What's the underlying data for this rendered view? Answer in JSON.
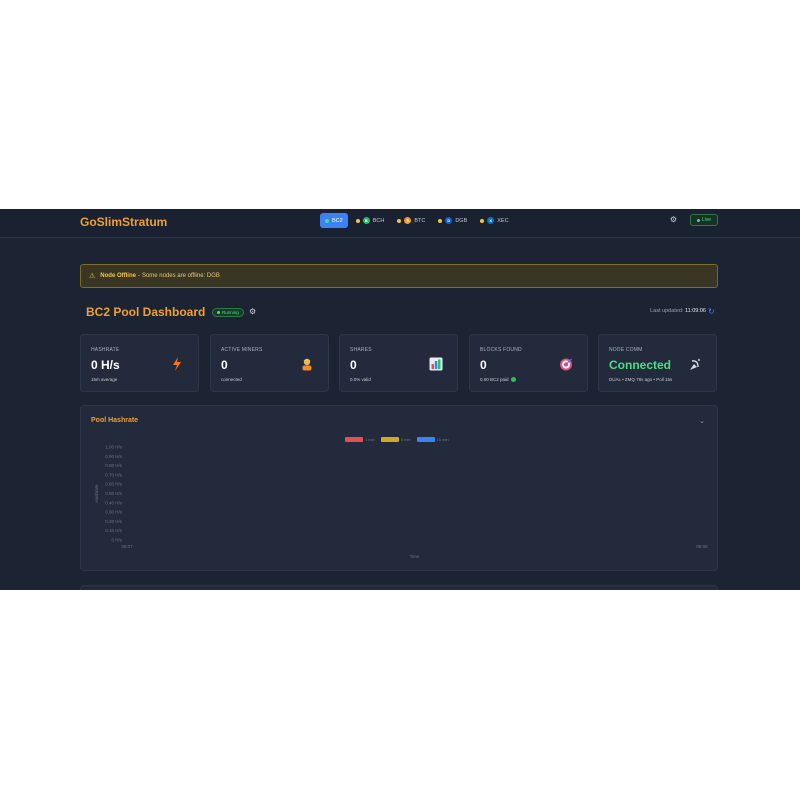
{
  "app": {
    "brand": "GoSlimStratum",
    "chains": [
      {
        "label": "BC2",
        "color": "#4ade80",
        "coin": "",
        "active": true
      },
      {
        "label": "BCH",
        "color": "#f4c542",
        "coin": "B",
        "coin_color": "#2bb673",
        "active": false
      },
      {
        "label": "BTC",
        "color": "#f4c542",
        "coin": "₿",
        "coin_color": "#f7931a",
        "active": false
      },
      {
        "label": "DGB",
        "color": "#f4c542",
        "coin": "D",
        "coin_color": "#0b63d1",
        "active": false
      },
      {
        "label": "XEC",
        "color": "#f4c542",
        "coin": "X",
        "coin_color": "#0074c2",
        "active": false
      }
    ],
    "live_label": "Live"
  },
  "alert": {
    "title": "Node Offline",
    "separator": " - ",
    "message": "Some nodes are offline: DGB"
  },
  "dashboard": {
    "title": "BC2 Pool Dashboard",
    "status": "Running",
    "last_updated_label": "Last updated:",
    "last_updated_time": "11:09:06"
  },
  "stats": [
    {
      "label": "HASHRATE",
      "value": "0 H/s",
      "sub": "15m average",
      "icon": "lightning-icon"
    },
    {
      "label": "ACTIVE MINERS",
      "value": "0",
      "sub": "connected",
      "icon": "miner-icon"
    },
    {
      "label": "SHARES",
      "value": "0",
      "sub": "0.0% valid",
      "icon": "bar-chart-icon"
    },
    {
      "label": "BLOCKS FOUND",
      "value": "0",
      "sub": "0.00 BC2 paid",
      "icon": "target-icon"
    },
    {
      "label": "NODE COMM",
      "value": "Connected",
      "sub": "DUAL • ZMQ 78s ago • Poll 15s",
      "icon": "satellite-icon"
    }
  ],
  "chart": {
    "panel_title": "Pool Hashrate",
    "x_label": "Time",
    "y_label": "Hashrate",
    "legend": [
      {
        "name": "1 min",
        "color": "#e0524f"
      },
      {
        "name": "5 min",
        "color": "#d4a52a"
      },
      {
        "name": "15 min",
        "color": "#3b82f6"
      }
    ]
  },
  "chart_data": {
    "type": "line",
    "title": "Pool Hashrate",
    "xlabel": "Time",
    "ylabel": "Hashrate",
    "x_ticks": [
      "09:07",
      "09:08"
    ],
    "y_ticks": [
      "1.00 H/s",
      "0.90 H/s",
      "0.80 H/s",
      "0.70 H/s",
      "0.60 H/s",
      "0.50 H/s",
      "0.40 H/s",
      "0.30 H/s",
      "0.20 H/s",
      "0.10 H/s",
      "0 H/s"
    ],
    "ylim": [
      0,
      1
    ],
    "grid": false,
    "legend_position": "top",
    "series": [
      {
        "name": "1 min",
        "values": []
      },
      {
        "name": "5 min",
        "values": []
      },
      {
        "name": "15 min",
        "values": []
      }
    ]
  }
}
